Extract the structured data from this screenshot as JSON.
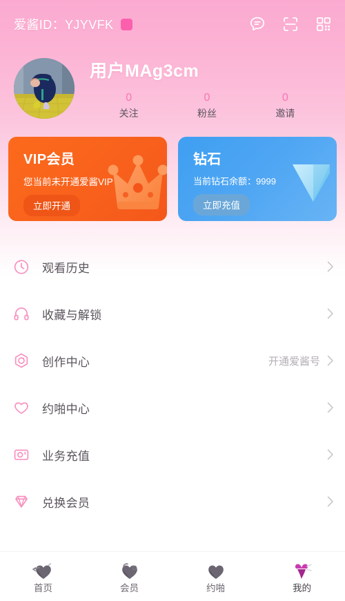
{
  "header": {
    "id_label": "爱酱ID：YJYVFK",
    "copy_chip_color": "#fb60ad",
    "icons": [
      {
        "name": "message-icon",
        "label": "消息"
      },
      {
        "name": "scan-icon",
        "label": "扫一扫"
      },
      {
        "name": "qrcode-icon",
        "label": "二维码"
      }
    ]
  },
  "profile": {
    "username": "用户MAg3cm",
    "avatar_alt": "用户头像",
    "stats": [
      {
        "value": "0",
        "label": "关注"
      },
      {
        "value": "0",
        "label": "粉丝"
      },
      {
        "value": "0",
        "label": "邀请"
      }
    ],
    "stat_value_color": "#fa74b4"
  },
  "cards": {
    "vip": {
      "title": "VIP会员",
      "subtitle": "您当前未开通爱酱VIP",
      "button": "立即开通",
      "bg_color": "#f9631c",
      "art": "crown-illustration"
    },
    "diamond": {
      "title": "钻石",
      "subtitle": "当前钻石余额：9999",
      "balance": "9999",
      "button": "立即充值",
      "bg_color": "#4fa6f3",
      "art": "diamond-illustration"
    }
  },
  "menu": {
    "items": [
      {
        "icon": "clock-icon",
        "label": "观看历史",
        "extra": ""
      },
      {
        "icon": "headphone-icon",
        "label": "收藏与解锁",
        "extra": ""
      },
      {
        "icon": "camera-hex-icon",
        "label": "创作中心",
        "extra": "开通爱酱号"
      },
      {
        "icon": "heart-icon",
        "label": "约啪中心",
        "extra": ""
      },
      {
        "icon": "card-camera-icon",
        "label": "业务充值",
        "extra": ""
      },
      {
        "icon": "diamond-icon",
        "label": "兑换会员",
        "extra": ""
      }
    ],
    "icon_color": "#f892c0"
  },
  "tabbar": {
    "tabs": [
      {
        "icon": "heart-arrow-icon",
        "label": "首页",
        "active": false
      },
      {
        "icon": "heart-lock-icon",
        "label": "会员",
        "active": false
      },
      {
        "icon": "heart-plain-icon",
        "label": "约啪",
        "active": false
      },
      {
        "icon": "heart-pink-icon",
        "label": "我的",
        "active": true
      }
    ],
    "active_color": "#c93bb0"
  }
}
